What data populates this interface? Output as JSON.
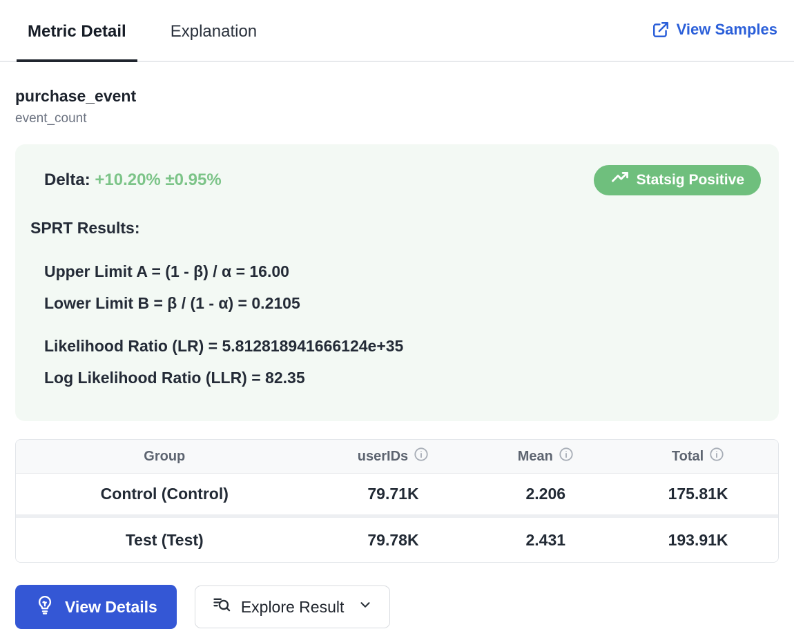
{
  "tabs": {
    "metric_detail": "Metric Detail",
    "explanation": "Explanation",
    "view_samples": "View Samples"
  },
  "metric": {
    "name": "purchase_event",
    "type": "event_count"
  },
  "results_panel": {
    "delta_label": "Delta:",
    "delta_value": "+10.20%",
    "delta_margin": "±0.95%",
    "badge_label": "Statsig Positive",
    "sprt_heading": "SPRT Results:",
    "upper_limit": "Upper Limit A = (1 - β) / α = 16.00",
    "lower_limit": "Lower Limit B = β / (1 - α) = 0.2105",
    "likelihood_ratio": "Likelihood Ratio (LR) = 5.812818941666124e+35",
    "log_likelihood_ratio": "Log Likelihood Ratio (LLR) = 82.35"
  },
  "table": {
    "headers": [
      "Group",
      "userIDs",
      "Mean",
      "Total"
    ],
    "rows": [
      {
        "group": "Control (Control)",
        "user_ids": "79.71K",
        "mean": "2.206",
        "total": "175.81K"
      },
      {
        "group": "Test (Test)",
        "user_ids": "79.78K",
        "mean": "2.431",
        "total": "193.91K"
      }
    ]
  },
  "actions": {
    "view_details": "View Details",
    "explore_result": "Explore Result"
  },
  "colors": {
    "link_blue": "#2b5fd9",
    "primary_button_blue": "#3457d5",
    "delta_green": "#7cc488",
    "badge_green": "#6fbf7d",
    "panel_bg": "#f3f9f4",
    "active_tab_underline": "#20252e",
    "table_header_bg": "#f8f9fa"
  }
}
